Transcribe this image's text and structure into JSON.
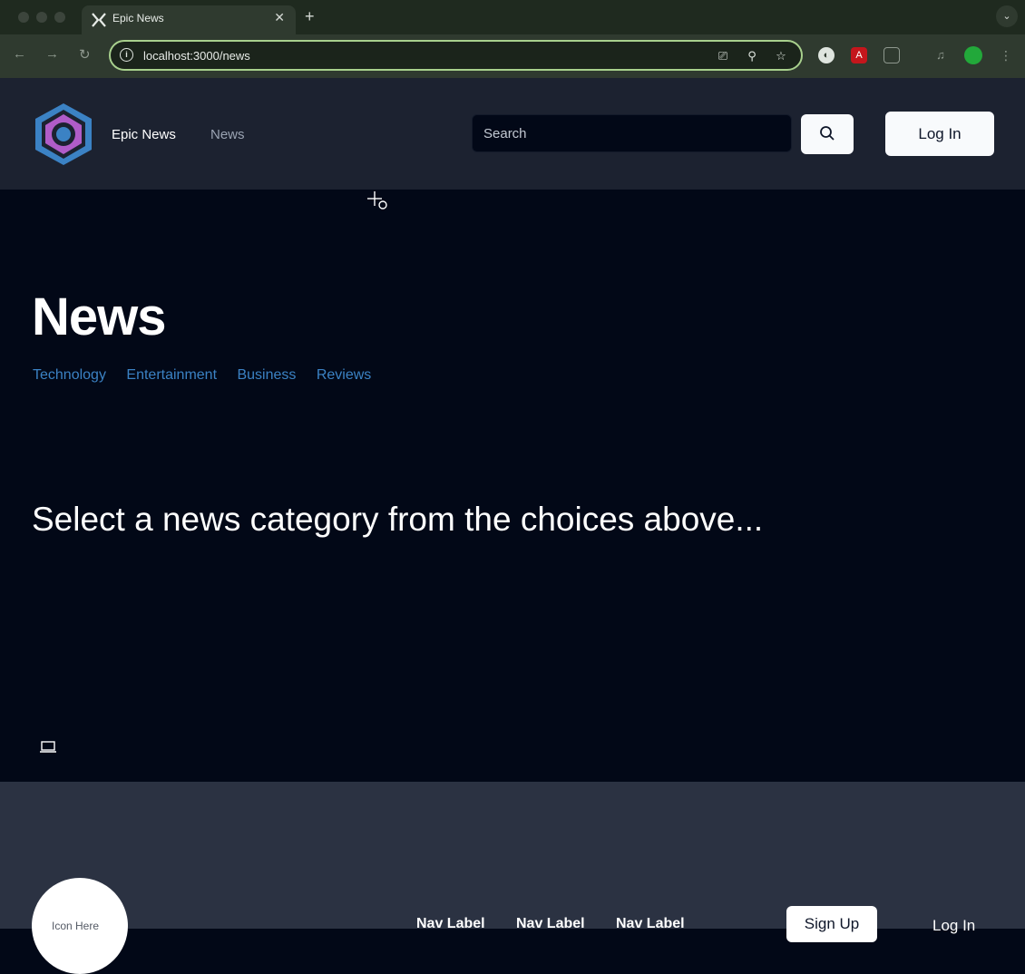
{
  "browser": {
    "tab_title": "Epic News",
    "url": "localhost:3000/news",
    "new_tab": "+",
    "tab_close": "✕"
  },
  "header": {
    "brand": "Epic News",
    "nav": [
      "News"
    ],
    "search_placeholder": "Search",
    "login_label": "Log In"
  },
  "main": {
    "title": "News",
    "categories": [
      "Technology",
      "Entertainment",
      "Business",
      "Reviews"
    ],
    "prompt": "Select a news category from the choices above..."
  },
  "footer": {
    "icon_placeholder": "Icon Here",
    "nav_labels": [
      "Nav Label",
      "Nav Label",
      "Nav Label"
    ],
    "signup_label": "Sign Up",
    "login_label": "Log In"
  },
  "colors": {
    "accent_link": "#3b82c4",
    "header_bg": "#1c2230",
    "main_bg": "#020817",
    "footer_bg": "#2b3242"
  }
}
